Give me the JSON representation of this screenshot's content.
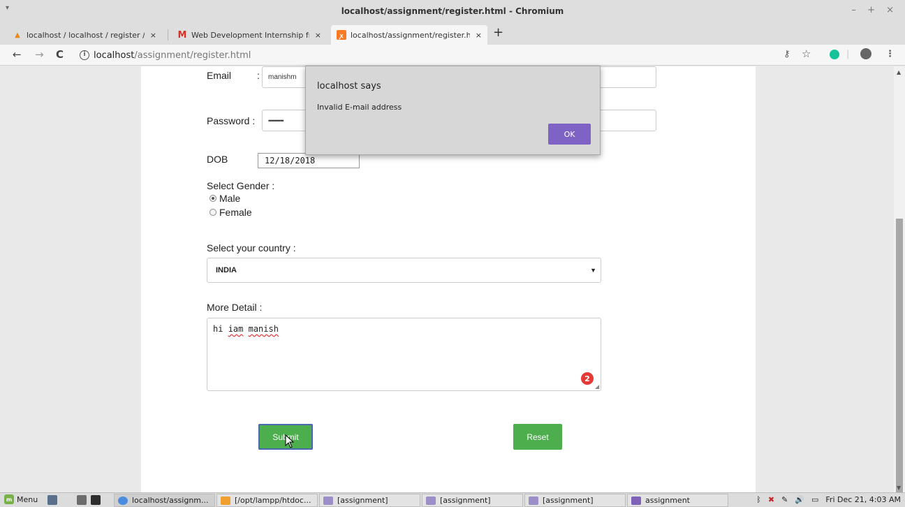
{
  "window": {
    "title": "localhost/assignment/register.html - Chromium",
    "menu_glyph": "▾",
    "controls": "– + ×"
  },
  "tabs": [
    {
      "label": "localhost / localhost / register /",
      "icon": "phpmyadmin-icon",
      "active": false
    },
    {
      "label": "Web Development Internship fr",
      "icon": "gmail-icon",
      "active": false
    },
    {
      "label": "localhost/assignment/register.h",
      "icon": "xampp-icon",
      "active": true
    }
  ],
  "tab_close": "×",
  "newtab": "+",
  "address": {
    "host": "localhost",
    "path": "/assignment/register.html"
  },
  "nav": {
    "back": "←",
    "forward": "→",
    "reload": "C"
  },
  "form": {
    "email_label": "Email",
    "email_colon": ":",
    "email_value": "manishm",
    "password_label": "Password :",
    "password_value": "••••••••••",
    "dob_label": "DOB",
    "dob_colon": ":",
    "dob_value": "12/18/2018",
    "gender_label": "Select Gender :",
    "gender_options": [
      "Male",
      "Female"
    ],
    "gender_selected": "Male",
    "country_label": "Select your country :",
    "country_value": "INDIA",
    "detail_label": "More Detail :",
    "detail_word1": "hi",
    "detail_word2": "iam",
    "detail_word3": "manish",
    "grammar_count": "2",
    "submit_label": "Submit",
    "reset_label": "Reset"
  },
  "dialog": {
    "title": "localhost says",
    "message": "Invalid E-mail address",
    "ok_label": "OK"
  },
  "taskbar": {
    "menu_label": "Menu",
    "items": [
      {
        "label": "localhost/assignm...",
        "icon_color": "#4a8de0"
      },
      {
        "label": "[/opt/lampp/htdoc...",
        "icon_color": "#f0a030"
      },
      {
        "label": "[assignment]",
        "icon_color": "#9c8fc7"
      },
      {
        "label": "[assignment]",
        "icon_color": "#9c8fc7"
      },
      {
        "label": "[assignment]",
        "icon_color": "#9c8fc7"
      },
      {
        "label": "assignment",
        "icon_color": "#7f62b8"
      }
    ],
    "clock": "Fri Dec 21,  4:03 AM"
  },
  "colors": {
    "button_green": "#4cae4c",
    "dialog_ok": "#7e63c4",
    "grammar_red": "#e53935"
  }
}
